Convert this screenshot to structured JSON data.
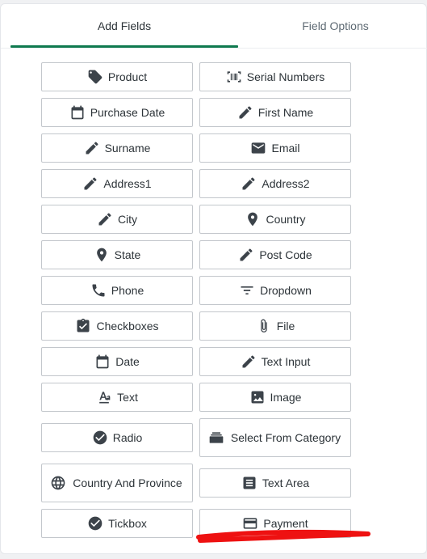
{
  "tabs": [
    {
      "label": "Add Fields",
      "active": true
    },
    {
      "label": "Field Options",
      "active": false
    }
  ],
  "colors": {
    "accent": "#0f7a4f",
    "annotation": "#ee1111"
  },
  "fields": [
    {
      "label": "Product",
      "icon": "tag-icon"
    },
    {
      "label": "Serial Numbers",
      "icon": "barcode-icon"
    },
    {
      "label": "Purchase Date",
      "icon": "calendar-icon"
    },
    {
      "label": "First Name",
      "icon": "pencil-icon"
    },
    {
      "label": "Surname",
      "icon": "pencil-icon"
    },
    {
      "label": "Email",
      "icon": "envelope-icon"
    },
    {
      "label": "Address1",
      "icon": "pencil-icon"
    },
    {
      "label": "Address2",
      "icon": "pencil-icon"
    },
    {
      "label": "City",
      "icon": "pencil-icon"
    },
    {
      "label": "Country",
      "icon": "map-pin-icon"
    },
    {
      "label": "State",
      "icon": "map-pin-icon"
    },
    {
      "label": "Post Code",
      "icon": "pencil-icon"
    },
    {
      "label": "Phone",
      "icon": "phone-icon"
    },
    {
      "label": "Dropdown",
      "icon": "filter-lines-icon"
    },
    {
      "label": "Checkboxes",
      "icon": "clipboard-check-icon"
    },
    {
      "label": "File",
      "icon": "paperclip-icon"
    },
    {
      "label": "Date",
      "icon": "calendar-icon"
    },
    {
      "label": "Text Input",
      "icon": "pencil-icon"
    },
    {
      "label": "Text",
      "icon": "text-format-icon"
    },
    {
      "label": "Image",
      "icon": "image-icon"
    },
    {
      "label": "Radio",
      "icon": "check-circle-icon"
    },
    {
      "label": "Select From Category",
      "icon": "stack-icon"
    },
    {
      "label": "Country And Province",
      "icon": "globe-icon"
    },
    {
      "label": "Text Area",
      "icon": "text-area-icon"
    },
    {
      "label": "Tickbox",
      "icon": "check-circle-icon"
    },
    {
      "label": "Payment",
      "icon": "credit-card-icon"
    }
  ]
}
